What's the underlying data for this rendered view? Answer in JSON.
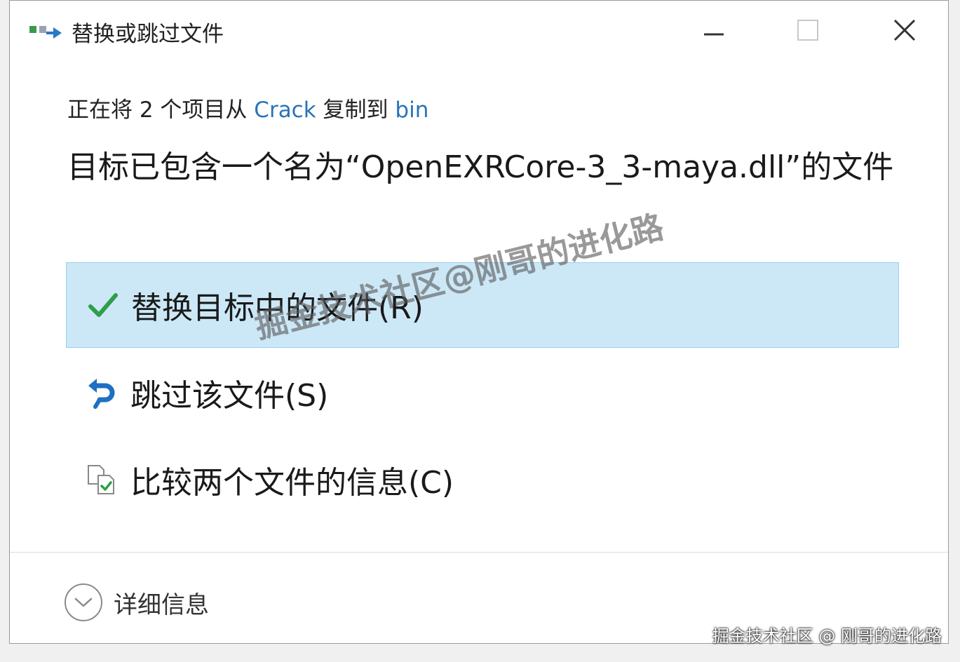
{
  "window": {
    "title": "替换或跳过文件"
  },
  "copy_status": {
    "prefix": "正在将 2 个项目从 ",
    "source": "Crack",
    "middle": " 复制到 ",
    "destination": "bin"
  },
  "headline": "目标已包含一个名为“OpenEXRCore-3_3-maya.dll”的文件",
  "options": [
    {
      "label": "替换目标中的文件(R)",
      "icon": "checkmark-icon",
      "selected": true
    },
    {
      "label": "跳过该文件(S)",
      "icon": "skip-arrow-icon",
      "selected": false
    },
    {
      "label": "比较两个文件的信息(C)",
      "icon": "compare-files-icon",
      "selected": false
    }
  ],
  "details": {
    "label": "详细信息"
  },
  "watermarks": {
    "diagonal": "掘金技术社区@刚哥的进化路",
    "corner": "掘金技术社区 @ 刚哥的进化路"
  },
  "colors": {
    "selected_bg": "#cce8f7",
    "selected_border": "#9bcfee",
    "link": "#2a74b8",
    "check_green": "#2e9e4a",
    "skip_blue": "#1f6fc2"
  }
}
